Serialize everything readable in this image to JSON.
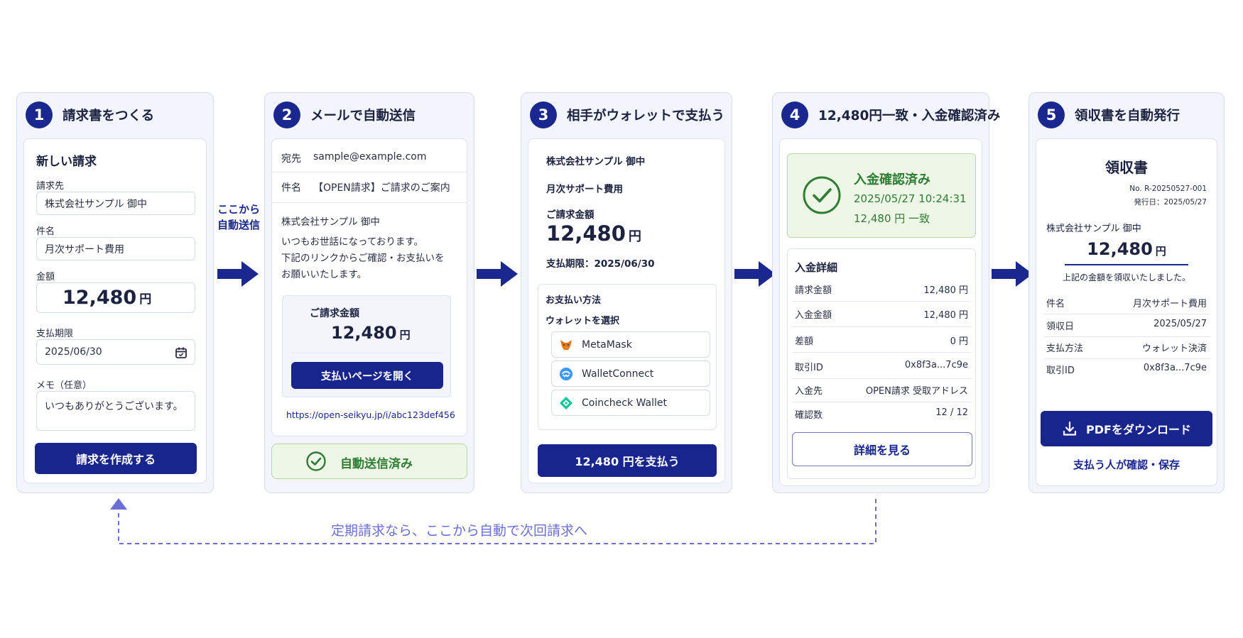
{
  "flow_side_label": [
    "ここから",
    "自動送信"
  ],
  "loop_label": "定期請求なら、ここから自動で次回請求へ",
  "step1": {
    "num": "1",
    "title": "請求書をつくる",
    "form_title": "新しい請求",
    "recipient_label": "請求先",
    "recipient_value": "株式会社サンプル 御中",
    "subject_label": "件名",
    "subject_value": "月次サポート費用",
    "amount_label": "金額",
    "amount_value": "12,480",
    "yen": "円",
    "due_label": "支払期限",
    "due_value": "2025/06/30",
    "memo_label": "メモ（任意）",
    "memo_value": "いつもありがとうございます。",
    "create_button": "請求を作成する"
  },
  "step2": {
    "num": "2",
    "title": "メールで自動送信",
    "to_label": "宛先",
    "to_value": "sample@example.com",
    "subject_label": "件名",
    "subject_value": "【OPEN請求】ご請求のご案内",
    "body_name": "株式会社サンプル 御中",
    "body_line1": "いつもお世話になっております。",
    "body_line2": "下記のリンクからご確認・お支払いを",
    "body_line3": "お願いいたします。",
    "box_label": "ご請求金額",
    "box_amount": "12,480",
    "yen": "円",
    "open_button": "支払いページを開く",
    "link": "https://open-seikyu.jp/i/abc123def456",
    "status": "自動送信済み"
  },
  "step3": {
    "num": "3",
    "title": "相手がウォレットで支払う",
    "company": "株式会社サンプル 御中",
    "subject": "月次サポート費用",
    "amount_label": "ご請求金額",
    "amount_value": "12,480",
    "yen": "円",
    "due": "支払期限：2025/06/30",
    "method_label": "お支払い方法",
    "select_label": "ウォレットを選択",
    "wallets": [
      "MetaMask",
      "WalletConnect",
      "Coincheck Wallet"
    ],
    "pay_button": "12,480 円を支払う"
  },
  "step4": {
    "num": "4",
    "title": "12,480円一致・入金確認済み",
    "confirm_title": "入金確認済み",
    "confirm_time": "2025/05/27 10:24:31",
    "confirm_match": "12,480 円 一致",
    "detail_title": "入金詳細",
    "rows": [
      {
        "label": "請求金額",
        "value": "12,480 円"
      },
      {
        "label": "入金金額",
        "value": "12,480 円"
      },
      {
        "label": "差額",
        "value": "0 円"
      },
      {
        "label": "取引ID",
        "value": "0x8f3a...7c9e"
      },
      {
        "label": "入金先",
        "value": "OPEN請求 受取アドレス"
      },
      {
        "label": "確認数",
        "value": "12 / 12"
      }
    ],
    "detail_button": "詳細を見る"
  },
  "step5": {
    "num": "5",
    "title": "領収書を自動発行",
    "doc_title": "領収書",
    "doc_no": "No. R-20250527-001",
    "issued": "発行日：2025/05/27",
    "recipient": "株式会社サンプル 御中",
    "amount": "12,480",
    "yen": "円",
    "received_text": "上記の金額を領収いたしました。",
    "rows": [
      {
        "label": "件名",
        "value": "月次サポート費用"
      },
      {
        "label": "領収日",
        "value": "2025/05/27"
      },
      {
        "label": "支払方法",
        "value": "ウォレット決済"
      },
      {
        "label": "取引ID",
        "value": "0x8f3a...7c9e"
      }
    ],
    "pdf_button": "PDFをダウンロード",
    "footer": "支払う人が確認・保存"
  },
  "colors": {
    "primary": "#17258d",
    "success": "#2e7d32",
    "success_bg": "#eef6e8",
    "loop": "#6b6fd6"
  }
}
